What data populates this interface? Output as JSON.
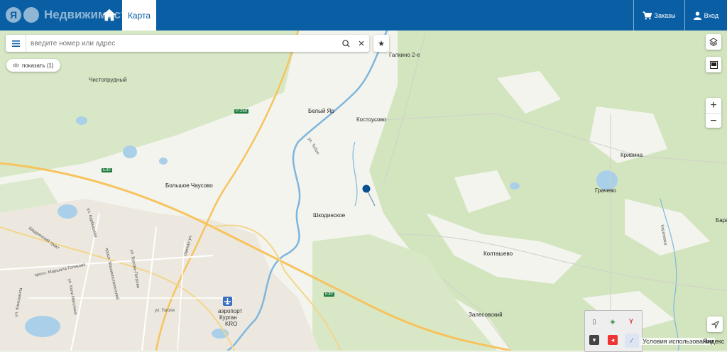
{
  "header": {
    "logo_letter": "Я",
    "logo_text": "Недвижимост",
    "tab_map": "Карта",
    "orders_label": "Заказы",
    "login_label": "Вход",
    "brand_color": "#0a5ea3"
  },
  "search": {
    "placeholder": "введите номер или адрес",
    "show_label": "показать (1)"
  },
  "map": {
    "places": [
      "Галкино 2-е",
      "Чистопрудный",
      "Белый Яр",
      "Костоусово",
      "Большое Чаусово",
      "Шкодинское",
      "Кривина",
      "Грачево",
      "Колташево",
      "Залесовский",
      "Бара",
      "аэропорт",
      "Курган",
      "KRO"
    ],
    "roads": [
      "Р-254",
      "E30",
      "E30",
      "ул. Тобол",
      "ул. Карбышева",
      "Шадринский тракт",
      "просп. Маршала Голикова",
      "ул. Бурова-Петрова",
      "просп. Машиностроителей",
      "ул. Коли Мяготина",
      "Омская ул.",
      "ул. Комсомола",
      "ул. Гоголя",
      "Карачевка"
    ]
  },
  "footer": {
    "terms": "Условия использования",
    "yandex": "Яндекс"
  }
}
